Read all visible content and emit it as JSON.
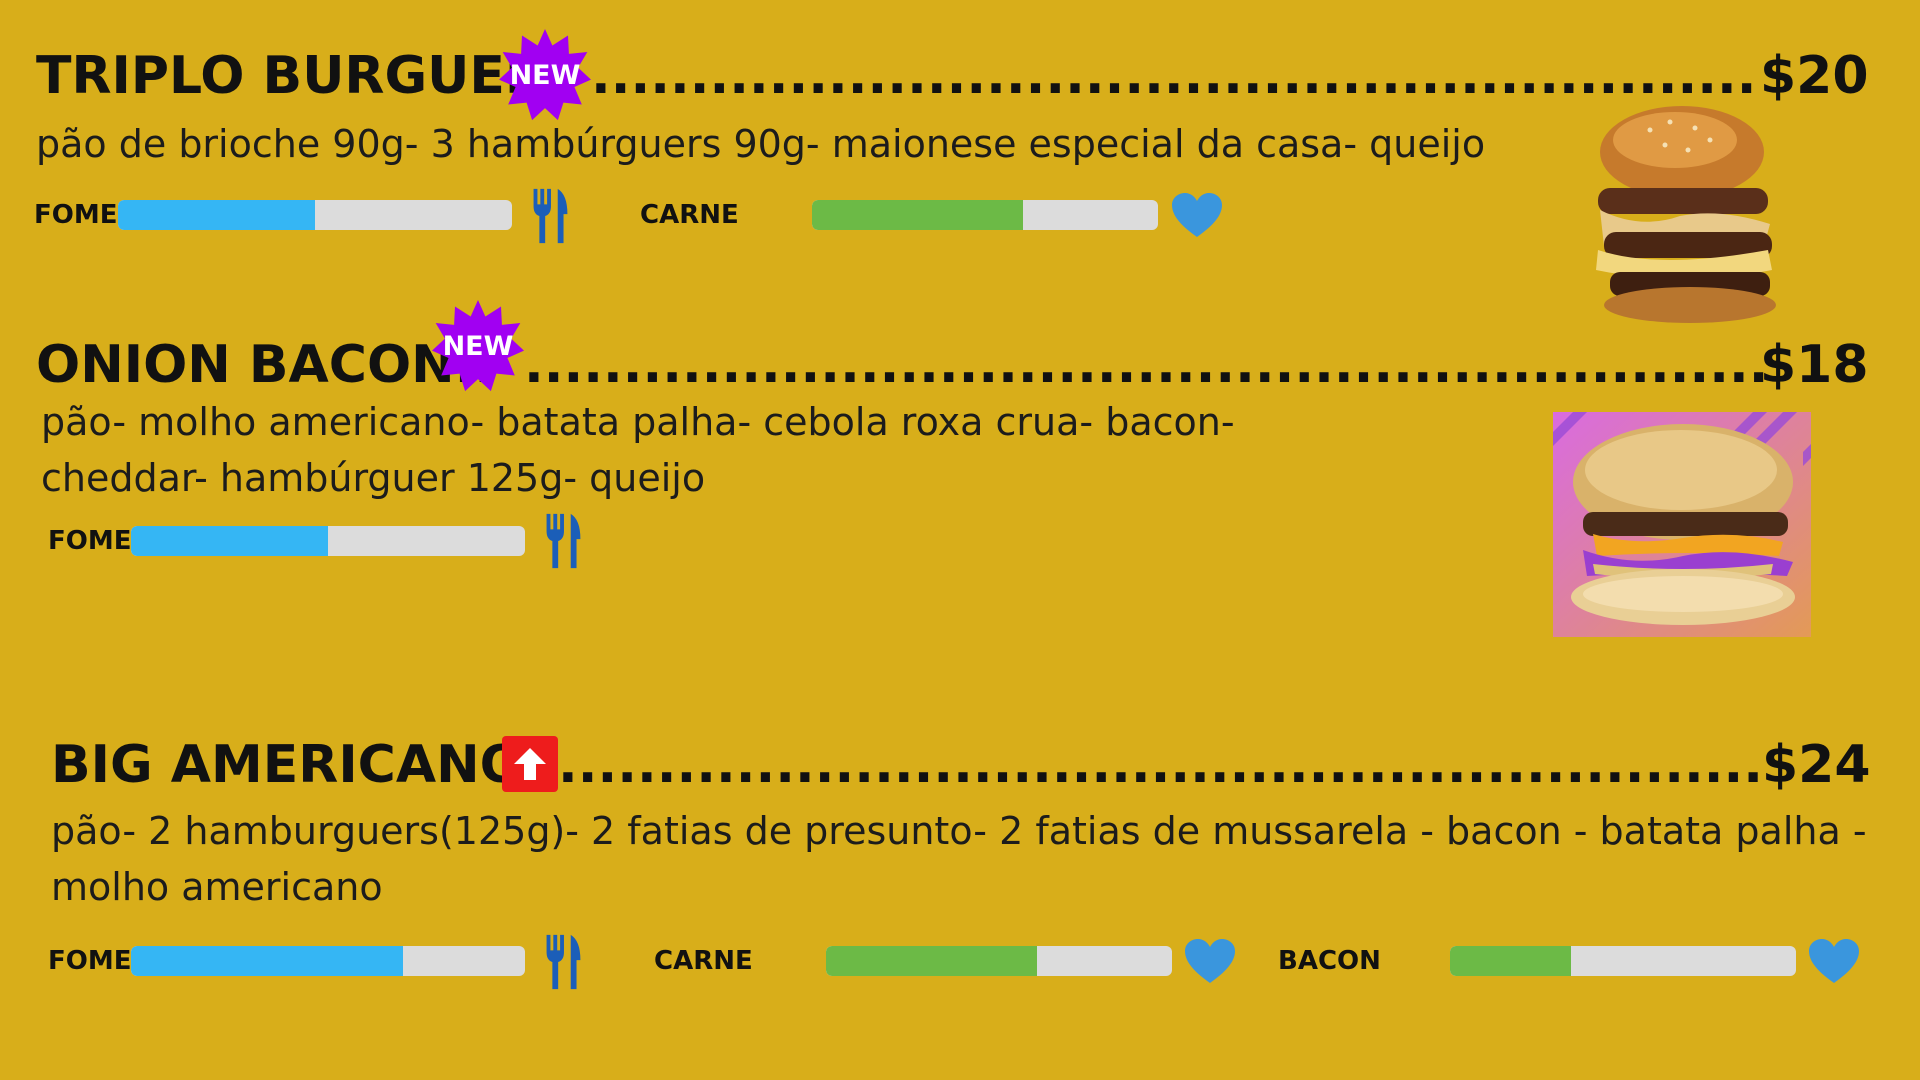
{
  "colors": {
    "background": "#D8AE1A",
    "fome_bar": "#35B6F4",
    "carne_bar": "#6CBA46",
    "track": "#DCDCDC",
    "badge_new": "#A100F2",
    "badge_up": "#EE1C1C",
    "icon_blue": "#1B5EB8",
    "heart_blue": "#3A96DD"
  },
  "items": [
    {
      "title": "TRIPLO BURGUER",
      "badge": "NEW",
      "badge_icon": "new-starburst-icon",
      "price": "$20",
      "description_lines": [
        "pão de brioche 90g-  3 hambúrguers 90g- maionese especial da casa-  queijo"
      ],
      "meters": [
        {
          "label": "FOME",
          "level": 0.5,
          "icon": "fork-knife-icon"
        },
        {
          "label": "CARNE",
          "level": 0.61,
          "icon": "heart-icon"
        }
      ],
      "image": "triple-burger-photo"
    },
    {
      "title": "ONION BACON..",
      "badge": "NEW",
      "badge_icon": "new-starburst-icon",
      "price": "$18",
      "description_lines": [
        "pão- molho americano- batata palha- cebola roxa crua- bacon-",
        "cheddar- hambúrguer 125g- queijo"
      ],
      "meters": [
        {
          "label": "FOME",
          "level": 0.5,
          "icon": "fork-knife-icon"
        }
      ],
      "image": "onion-bacon-burger-photo"
    },
    {
      "title": "BIG AMERICANO..",
      "badge_icon": "arrow-up-icon",
      "price": "$24",
      "description_lines": [
        "pão- 2 hamburguers(125g)- 2 fatias de presunto- 2 fatias de mussarela - bacon - batata palha -",
        "molho americano"
      ],
      "meters": [
        {
          "label": "FOME",
          "level": 0.69,
          "icon": "fork-knife-icon"
        },
        {
          "label": "CARNE",
          "level": 0.61,
          "icon": "heart-icon"
        },
        {
          "label": "BACON",
          "level": 0.35,
          "icon": "heart-icon"
        }
      ]
    }
  ]
}
